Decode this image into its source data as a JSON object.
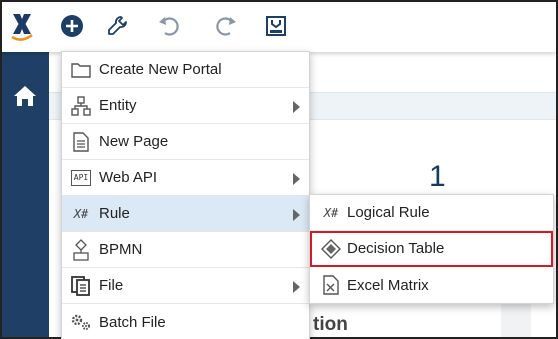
{
  "menu": {
    "items": [
      {
        "label": "Create New Portal",
        "icon": "folder-icon",
        "has_submenu": false
      },
      {
        "label": "Entity",
        "icon": "entity-hierarchy-icon",
        "has_submenu": true
      },
      {
        "label": "New Page",
        "icon": "page-icon",
        "has_submenu": false
      },
      {
        "label": "Web API",
        "icon": "api-icon",
        "has_submenu": true
      },
      {
        "label": "Rule",
        "icon": "rule-icon",
        "has_submenu": true
      },
      {
        "label": "BPMN",
        "icon": "bpmn-icon",
        "has_submenu": false
      },
      {
        "label": "File",
        "icon": "file-icon",
        "has_submenu": true
      },
      {
        "label": "Batch File",
        "icon": "gears-icon",
        "has_submenu": false
      }
    ]
  },
  "submenu": {
    "items": [
      {
        "label": "Logical Rule",
        "icon": "rule-icon"
      },
      {
        "label": "Decision Table",
        "icon": "diamond-icon"
      },
      {
        "label": "Excel Matrix",
        "icon": "excel-icon"
      }
    ]
  },
  "background": {
    "number": "1",
    "partial_text": "tion"
  },
  "api_icon_text": "API",
  "rule_icon_text": "X#",
  "colors": {
    "sidebar": "#1f3f66",
    "accent": "#163a60",
    "highlight_border": "#d01c24",
    "active_row": "#dbe9f6"
  }
}
